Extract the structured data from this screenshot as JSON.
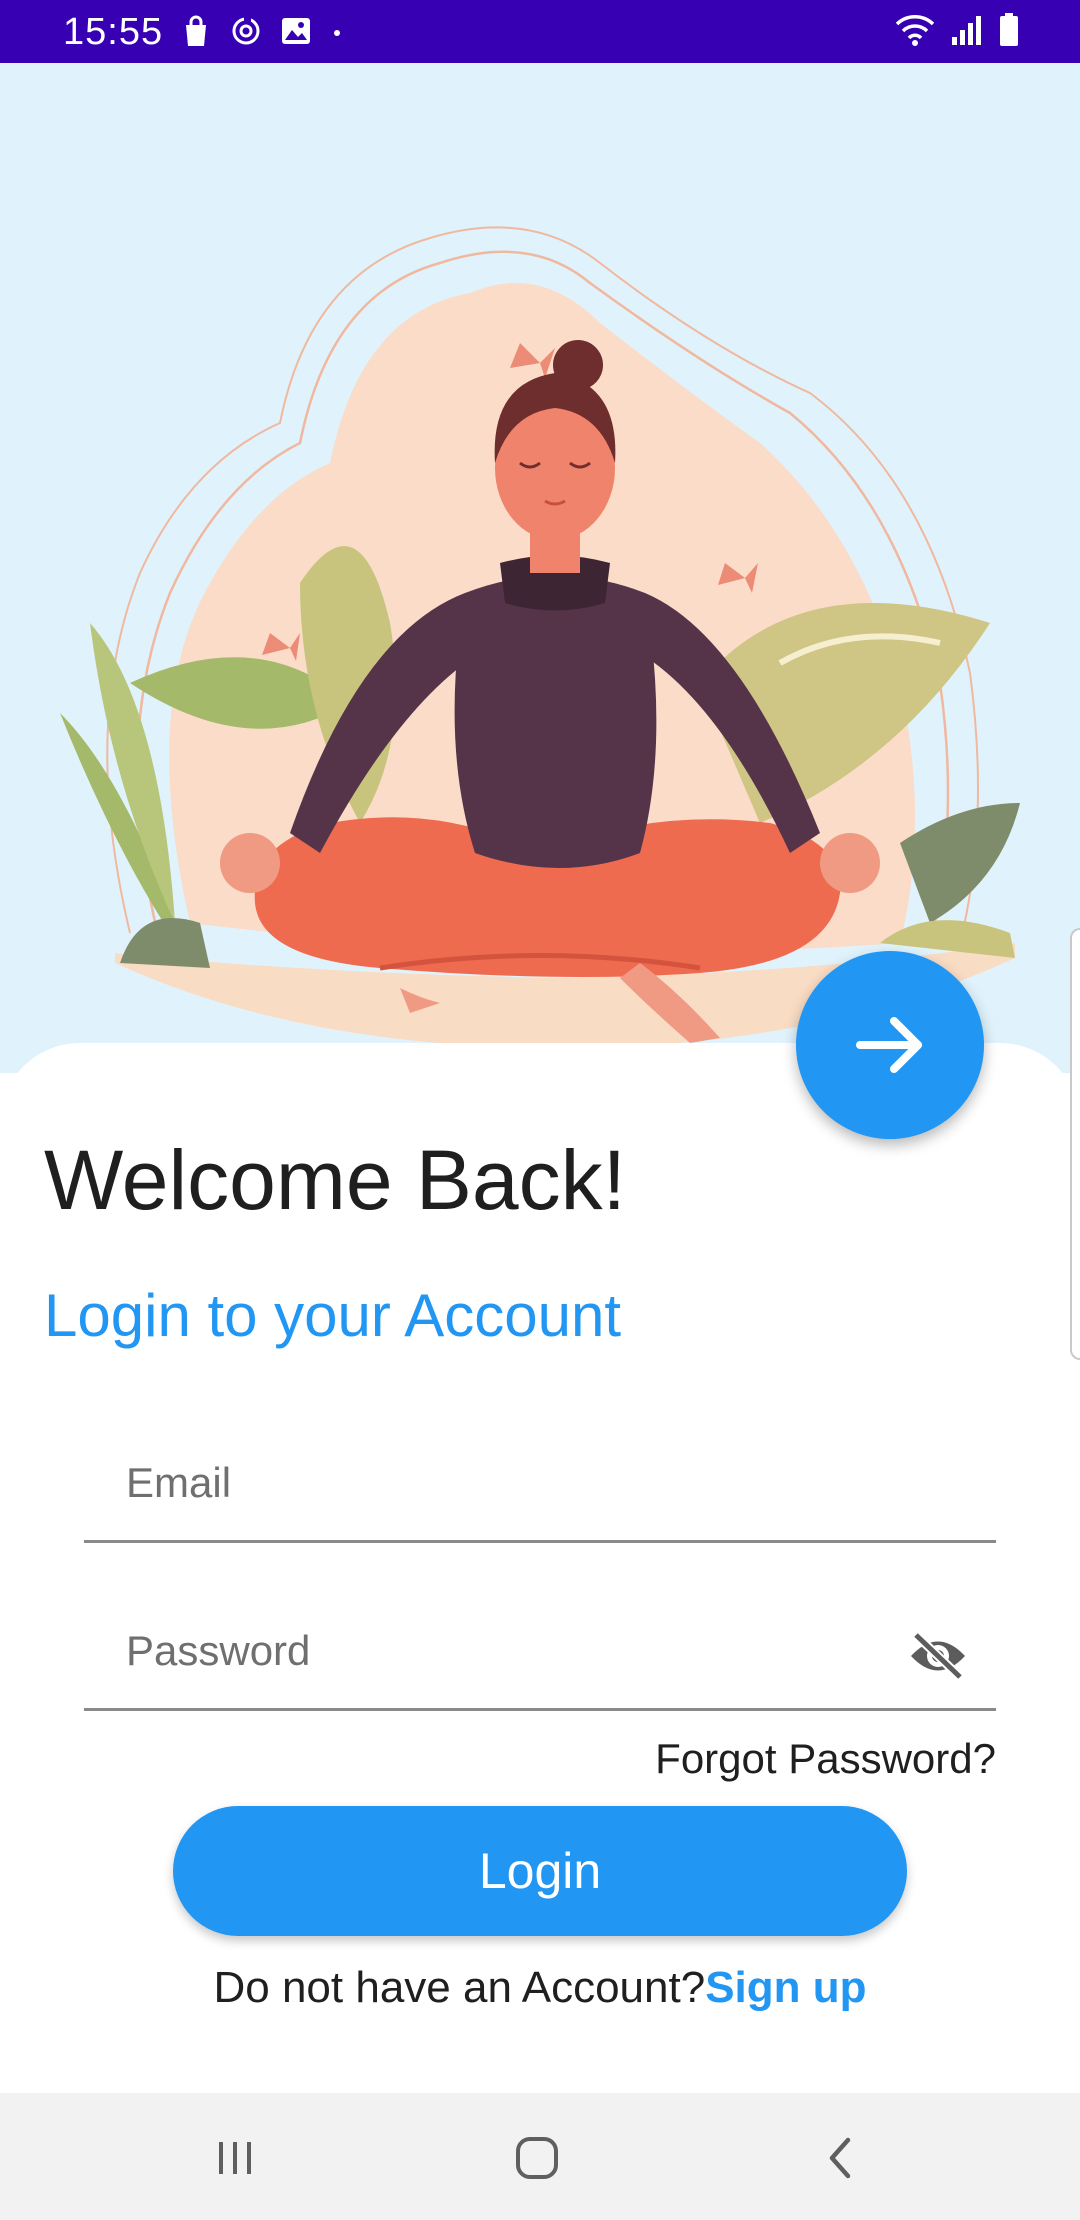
{
  "status_bar": {
    "time": "15:55",
    "icons_left": [
      "shopping-bag-icon",
      "sync-icon",
      "image-icon",
      "dot-icon"
    ],
    "icons_right": [
      "wifi-icon",
      "signal-icon",
      "battery-icon"
    ]
  },
  "hero": {
    "illustration": "meditating-woman-illustration"
  },
  "fab": {
    "icon": "arrow-right-icon"
  },
  "login": {
    "title": "Welcome Back!",
    "subtitle": "Login to your Account",
    "email_placeholder": "Email",
    "password_placeholder": "Password",
    "forgot_password": "Forgot Password?",
    "login_button": "Login",
    "signup_prompt": "Do not have an Account?",
    "signup_link": "Sign up"
  },
  "nav_bar": {
    "items": [
      "recents-icon",
      "home-icon",
      "back-icon"
    ]
  },
  "colors": {
    "status_bar": "#3700b3",
    "hero_background": "#e0f3fc",
    "accent": "#2196f3",
    "text_primary": "#1f1f1f",
    "nav_background": "#f2f2f2"
  }
}
